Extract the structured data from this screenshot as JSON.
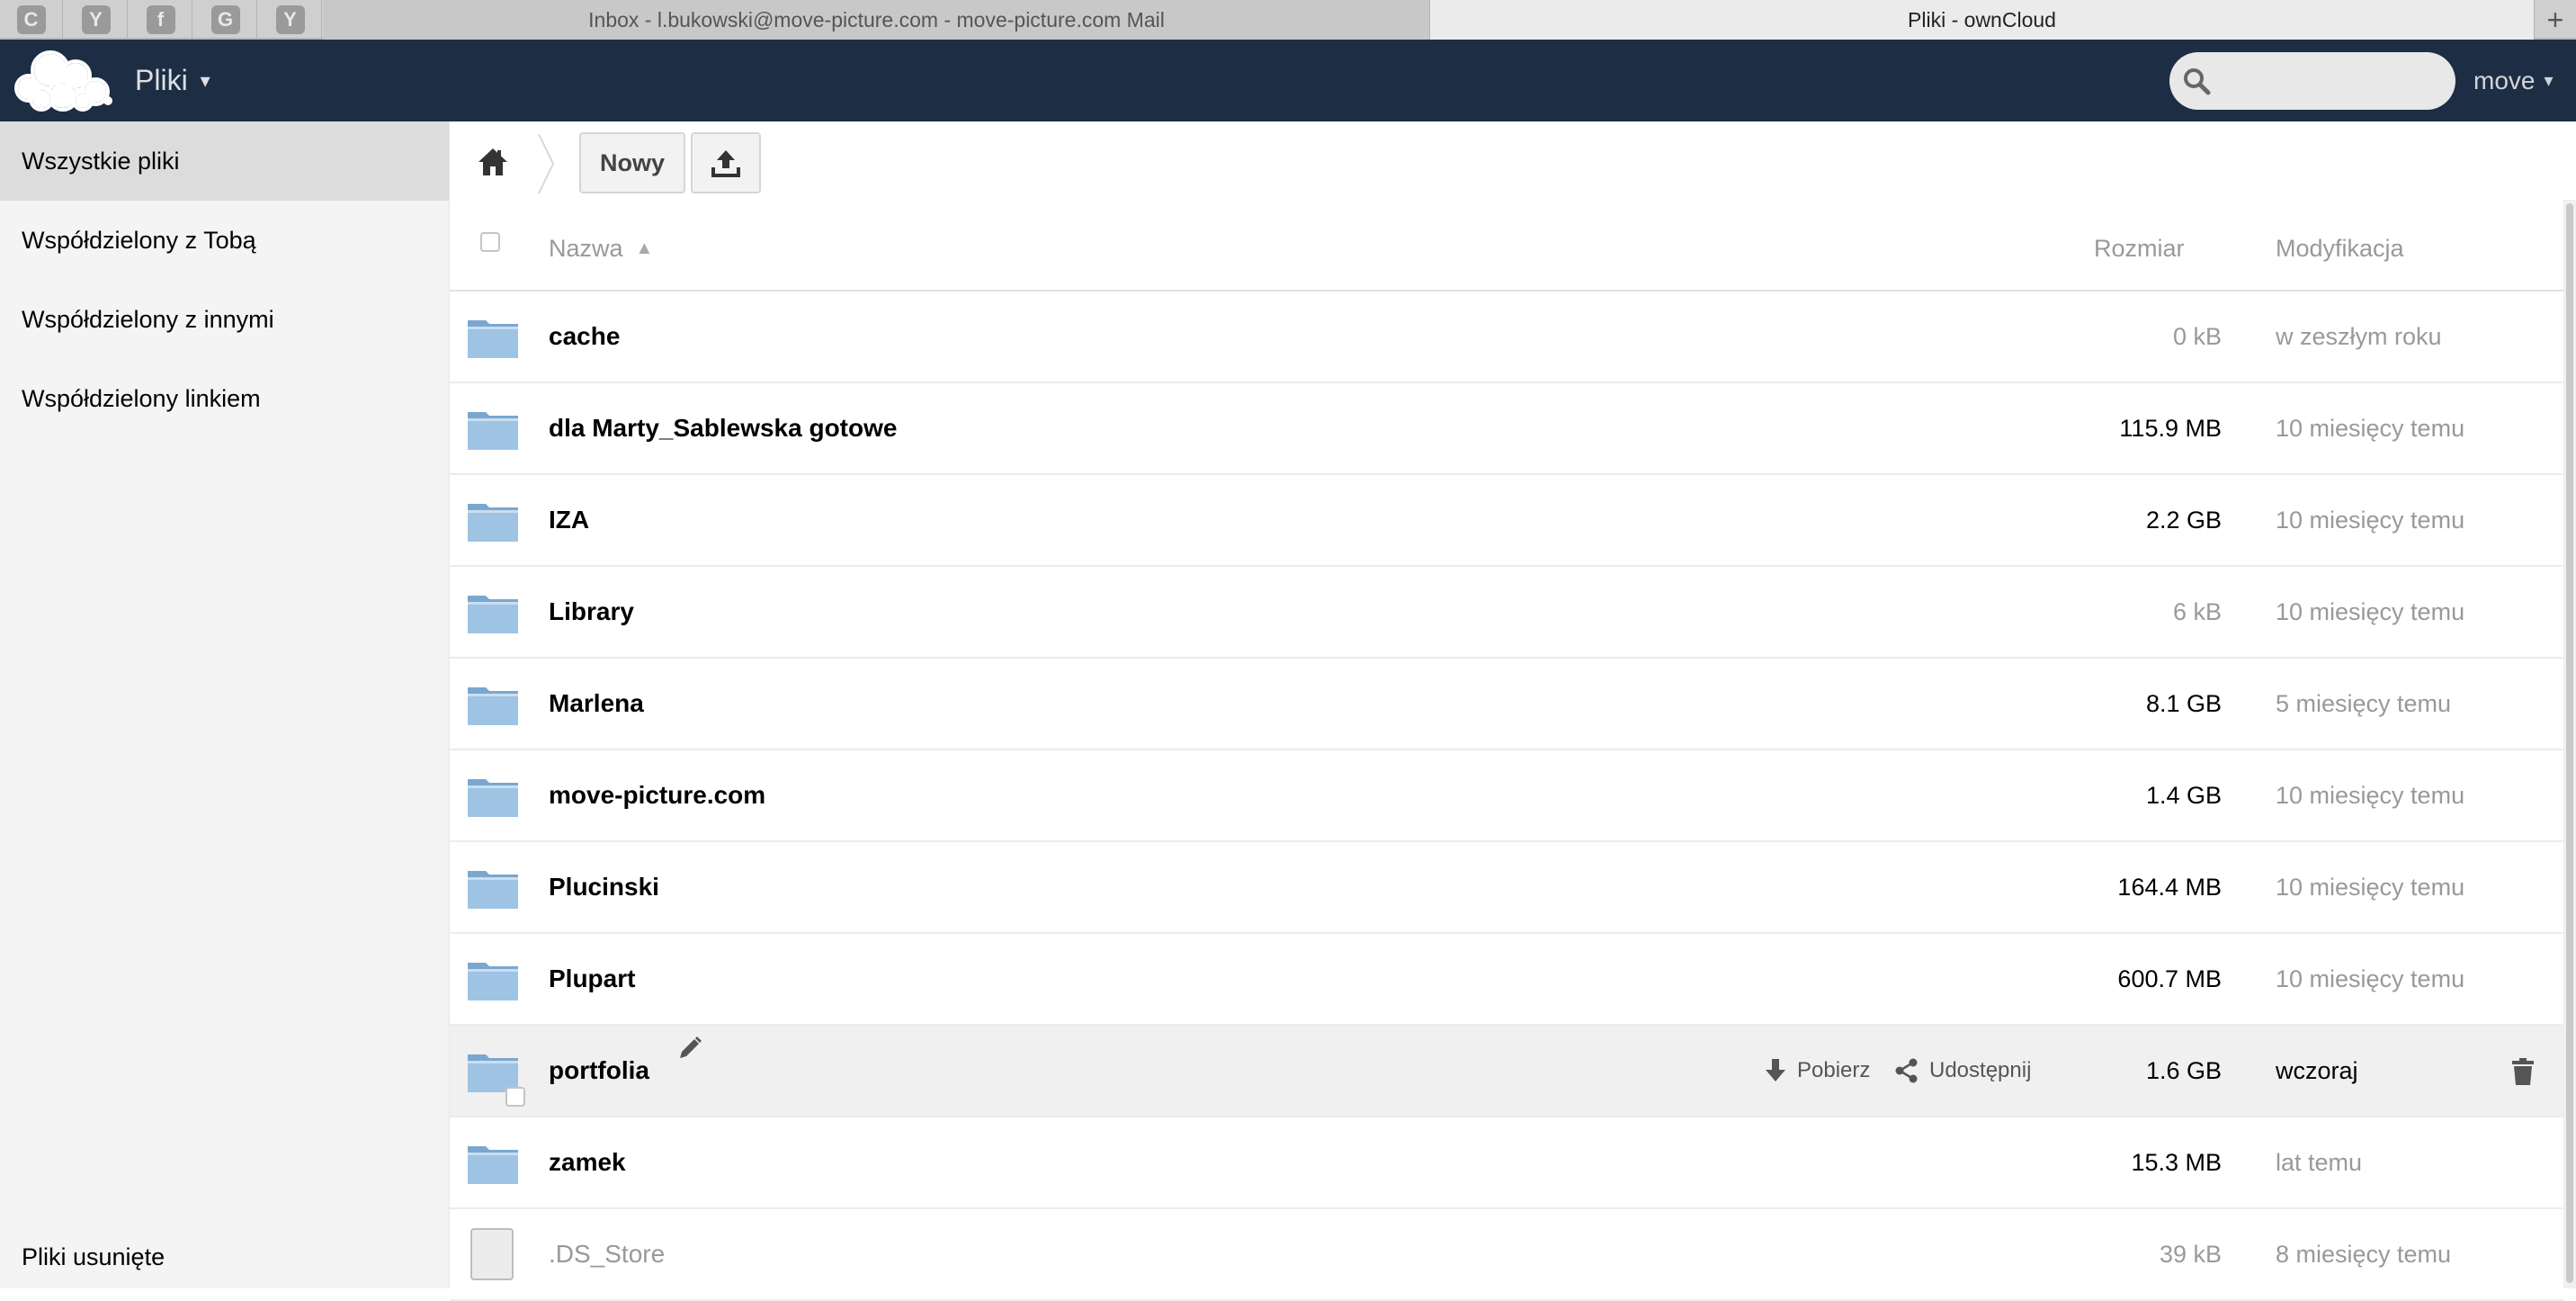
{
  "browser": {
    "pinned_tabs": [
      "C",
      "Y",
      "f",
      "G",
      "Y"
    ],
    "tabs": [
      {
        "title": "Inbox - l.bukowski@move-picture.com - move-picture.com Mail",
        "active": false
      },
      {
        "title": "Pliki - ownCloud",
        "active": true
      }
    ],
    "new_tab": "+"
  },
  "header": {
    "app_name": "Pliki",
    "app_caret": "▾",
    "search_value": "",
    "user_name": "move",
    "user_caret": "▾",
    "colors": {
      "header_bg": "#1d2d44"
    }
  },
  "sidebar": {
    "items": [
      {
        "label": "Wszystkie pliki",
        "active": true
      },
      {
        "label": "Współdzielony z Tobą",
        "active": false
      },
      {
        "label": "Współdzielony z innymi",
        "active": false
      },
      {
        "label": "Współdzielony linkiem",
        "active": false
      }
    ],
    "trash_label": "Pliki usunięte"
  },
  "controls": {
    "new_label": "Nowy",
    "home_icon": "home-icon",
    "upload_icon": "upload-icon"
  },
  "table": {
    "columns": {
      "name": "Nazwa",
      "sort_indicator": "▲",
      "size": "Rozmiar",
      "modified": "Modyfikacja"
    },
    "rows": [
      {
        "name": "cache",
        "type": "folder",
        "size": "0 kB",
        "modified": "w zeszłym roku"
      },
      {
        "name": "dla Marty_Sablewska gotowe",
        "type": "folder",
        "size": "115.9 MB",
        "modified": "10 miesięcy temu"
      },
      {
        "name": "IZA",
        "type": "folder",
        "size": "2.2 GB",
        "modified": "10 miesięcy temu"
      },
      {
        "name": "Library",
        "type": "folder",
        "size": "6 kB",
        "modified": "10 miesięcy temu"
      },
      {
        "name": "Marlena",
        "type": "folder",
        "size": "8.1 GB",
        "modified": "5 miesięcy temu"
      },
      {
        "name": "move-picture.com",
        "type": "folder",
        "size": "1.4 GB",
        "modified": "10 miesięcy temu"
      },
      {
        "name": "Plucinski",
        "type": "folder",
        "size": "164.4 MB",
        "modified": "10 miesięcy temu"
      },
      {
        "name": "Plupart",
        "type": "folder",
        "size": "600.7 MB",
        "modified": "10 miesięcy temu"
      },
      {
        "name": "portfolia",
        "type": "folder",
        "size": "1.6 GB",
        "modified": "wczoraj",
        "hovered": true
      },
      {
        "name": "zamek",
        "type": "folder",
        "size": "15.3 MB",
        "modified": "lat temu"
      },
      {
        "name": ".DS_Store",
        "type": "file",
        "size": "39 kB",
        "modified": "8 miesięcy temu"
      }
    ],
    "row_actions": {
      "download_label": "Pobierz",
      "share_label": "Udostępnij"
    }
  }
}
